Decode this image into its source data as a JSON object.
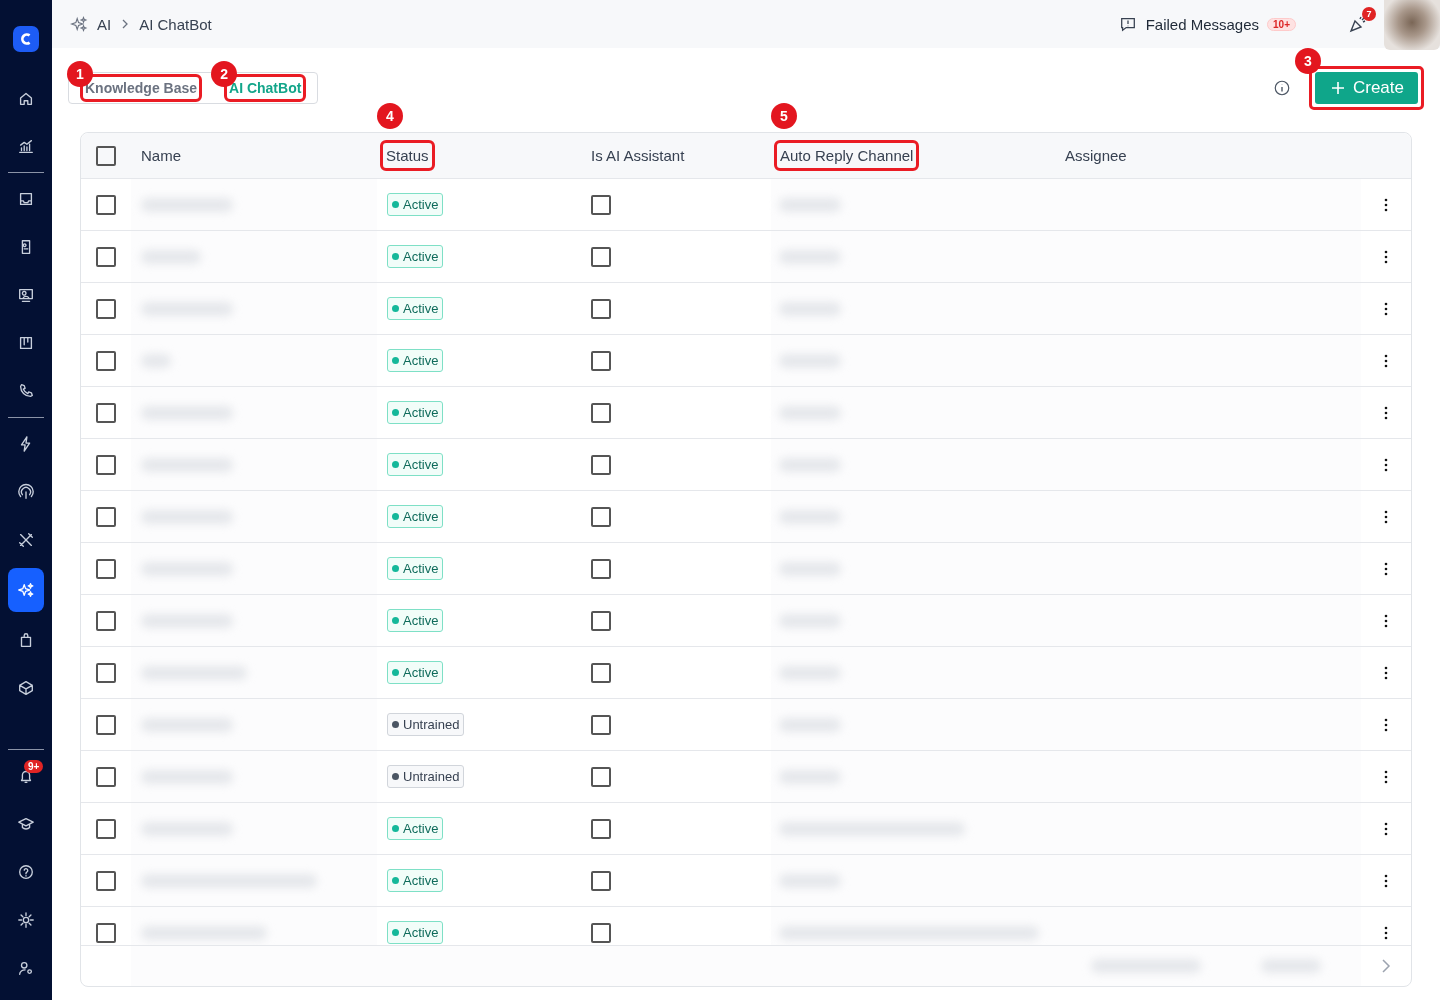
{
  "breadcrumb": {
    "items": [
      "AI",
      "AI ChatBot"
    ]
  },
  "top_bar": {
    "failed_messages": {
      "label": "Failed Messages",
      "count": "10+"
    },
    "notification_count": "7"
  },
  "sidebar": {
    "items": [
      {
        "kind": "home",
        "selected": false
      },
      {
        "kind": "chart",
        "selected": false
      },
      {
        "kind": "divider"
      },
      {
        "kind": "inbox",
        "selected": false
      },
      {
        "kind": "phonebook",
        "selected": false
      },
      {
        "kind": "contact",
        "selected": false
      },
      {
        "kind": "board",
        "selected": false
      },
      {
        "kind": "phone",
        "selected": false
      },
      {
        "kind": "divider"
      },
      {
        "kind": "bolt",
        "selected": false
      },
      {
        "kind": "broadcast",
        "selected": false
      },
      {
        "kind": "tools",
        "selected": false
      },
      {
        "kind": "sparkle",
        "selected": true
      },
      {
        "kind": "bag",
        "selected": false
      },
      {
        "kind": "box",
        "selected": false
      }
    ],
    "bottom_items": [
      {
        "kind": "bell",
        "selected": false,
        "badge": "9+"
      },
      {
        "kind": "cap",
        "selected": false
      },
      {
        "kind": "help",
        "selected": false
      },
      {
        "kind": "gear",
        "selected": false
      },
      {
        "kind": "usergear",
        "selected": false
      }
    ]
  },
  "tabs": [
    {
      "label": "Knowledge Base",
      "selected": false,
      "marker": "1"
    },
    {
      "label": "AI ChatBot",
      "selected": true,
      "marker": "2"
    }
  ],
  "create_button": {
    "label": "Create",
    "marker": "3"
  },
  "table": {
    "select_all_checked": false,
    "columns": [
      {
        "label": "Name"
      },
      {
        "label": "Status",
        "marker": "4"
      },
      {
        "label": "Is AI Assistant"
      },
      {
        "label": "Auto Reply Channel",
        "marker": "5"
      },
      {
        "label": "Assignee"
      }
    ],
    "rows": [
      {
        "selected": false,
        "status": "Active",
        "kind": "active",
        "is_ai_assistant": false
      },
      {
        "selected": false,
        "status": "Active",
        "kind": "active",
        "is_ai_assistant": false
      },
      {
        "selected": false,
        "status": "Active",
        "kind": "active",
        "is_ai_assistant": false
      },
      {
        "selected": false,
        "status": "Active",
        "kind": "active",
        "is_ai_assistant": false
      },
      {
        "selected": false,
        "status": "Active",
        "kind": "active",
        "is_ai_assistant": false
      },
      {
        "selected": false,
        "status": "Active",
        "kind": "active",
        "is_ai_assistant": false
      },
      {
        "selected": false,
        "status": "Active",
        "kind": "active",
        "is_ai_assistant": false
      },
      {
        "selected": false,
        "status": "Active",
        "kind": "active",
        "is_ai_assistant": false
      },
      {
        "selected": false,
        "status": "Active",
        "kind": "active",
        "is_ai_assistant": false
      },
      {
        "selected": false,
        "status": "Active",
        "kind": "active",
        "is_ai_assistant": false
      },
      {
        "selected": false,
        "status": "Untrained",
        "kind": "untrained",
        "is_ai_assistant": false
      },
      {
        "selected": false,
        "status": "Untrained",
        "kind": "untrained",
        "is_ai_assistant": false
      },
      {
        "selected": false,
        "status": "Active",
        "kind": "active",
        "is_ai_assistant": false
      },
      {
        "selected": false,
        "status": "Active",
        "kind": "active",
        "is_ai_assistant": false
      },
      {
        "selected": false,
        "status": "Active",
        "kind": "active",
        "is_ai_assistant": false
      }
    ]
  }
}
